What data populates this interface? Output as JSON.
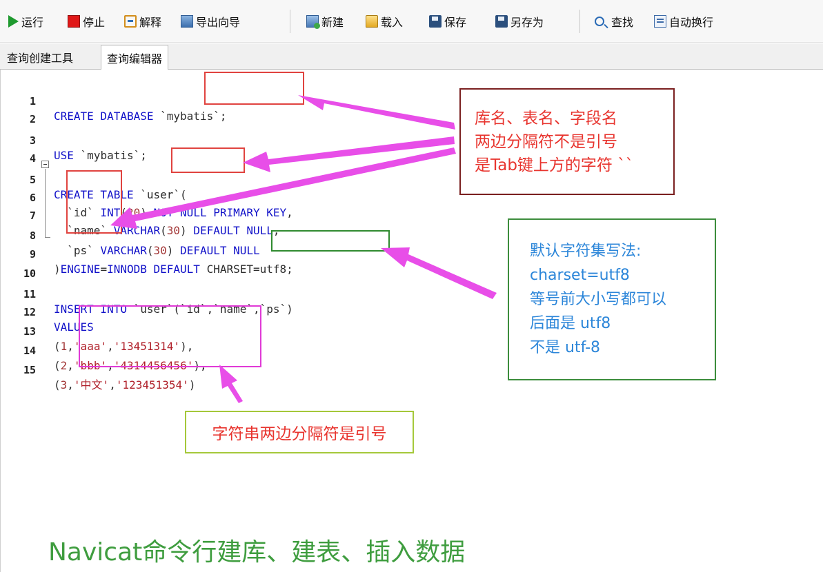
{
  "toolbar": {
    "run": "运行",
    "stop": "停止",
    "explain": "解释",
    "export_wizard": "导出向导",
    "new": "新建",
    "load": "载入",
    "save": "保存",
    "save_as": "另存为",
    "find": "查找",
    "word_wrap": "自动换行"
  },
  "tabs": [
    {
      "label": "查询创建工具",
      "active": false
    },
    {
      "label": "查询编辑器",
      "active": true
    }
  ],
  "editor": {
    "lines": [
      {
        "n": "1",
        "text": "CREATE DATABASE `mybatis`;"
      },
      {
        "n": "2",
        "text": ""
      },
      {
        "n": "3",
        "text": "USE `mybatis`;"
      },
      {
        "n": "4",
        "text": ""
      },
      {
        "n": "5",
        "text": "CREATE TABLE `user`("
      },
      {
        "n": "6",
        "text": "  `id` INT(20) NOT NULL PRIMARY KEY,"
      },
      {
        "n": "7",
        "text": "  `name` VARCHAR(30) DEFAULT NULL,"
      },
      {
        "n": "8",
        "text": "  `ps` VARCHAR(30) DEFAULT NULL"
      },
      {
        "n": "9",
        "text": ")ENGINE=INNODB DEFAULT CHARSET=utf8;"
      },
      {
        "n": "10",
        "text": ""
      },
      {
        "n": "11",
        "text": "INSERT INTO `user`(`id`,`name`,`ps`)"
      },
      {
        "n": "12",
        "text": "VALUES"
      },
      {
        "n": "13",
        "text": "(1,'aaa','13451314'),"
      },
      {
        "n": "14",
        "text": "(2,'bbb','4314456456'),"
      },
      {
        "n": "15",
        "text": "(3,'中文','123451354')"
      }
    ]
  },
  "annotations": {
    "identifier_note": [
      "库名、表名、字段名",
      "两边分隔符不是引号",
      "是Tab键上方的字符 ``"
    ],
    "charset_note": [
      "默认字符集写法:",
      "charset=utf8",
      "等号前大小写都可以",
      "后面是 utf8",
      "不是 utf-8"
    ],
    "string_note": "字符串两边分隔符是引号",
    "caption": "Navicat命令行建库、建表、插入数据"
  },
  "colors": {
    "identifier_box": "#e0433f",
    "identifier_note_border": "#7a1f1f",
    "identifier_note_text": "#e8352f",
    "charset_box": "#2f8a2f",
    "charset_note_text": "#2c86d9",
    "string_box": "#e03ad6",
    "string_note_border": "#a5c83a",
    "string_note_text": "#e8352f",
    "arrow": "#e84ee8",
    "caption": "#3f9d3f"
  }
}
